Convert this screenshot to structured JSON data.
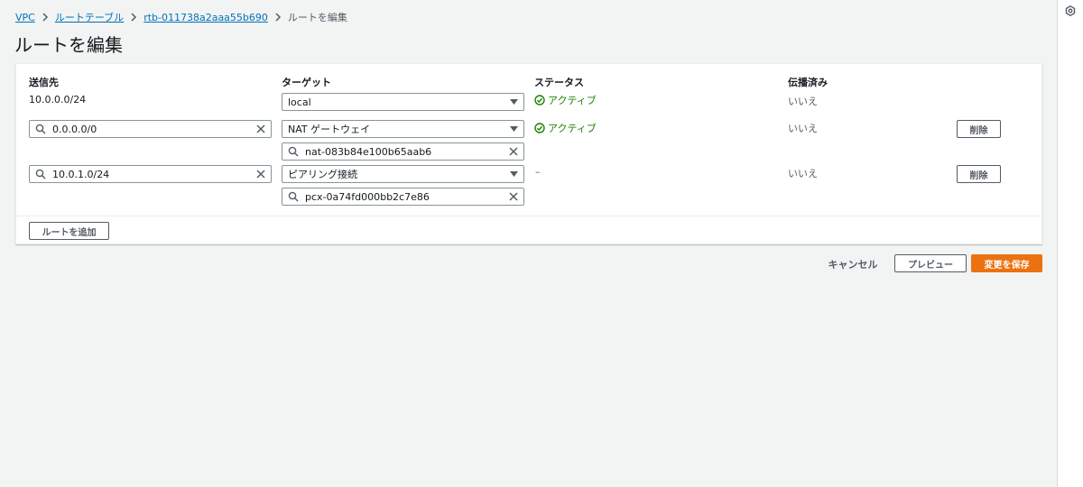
{
  "breadcrumb": {
    "items": [
      "VPC",
      "ルートテーブル",
      "rtb-011738a2aaa55b690"
    ],
    "current": "ルートを編集"
  },
  "page": {
    "title": "ルートを編集"
  },
  "table": {
    "headers": {
      "destination": "送信先",
      "target": "ターゲット",
      "status": "ステータス",
      "propagated": "伝播済み"
    },
    "rows": [
      {
        "destination": "10.0.0.0/24",
        "target_type": "local",
        "target_id": "",
        "status": "アクティブ",
        "propagated": "いいえ",
        "delete_label": ""
      },
      {
        "destination": "0.0.0.0/0",
        "target_type": "NAT ゲートウェイ",
        "target_id": "nat-083b84e100b65aab6",
        "status": "アクティブ",
        "propagated": "いいえ",
        "delete_label": "削除"
      },
      {
        "destination": "10.0.1.0/24",
        "target_type": "ピアリング接続",
        "target_id": "pcx-0a74fd000bb2c7e86",
        "status": "–",
        "propagated": "いいえ",
        "delete_label": "削除"
      }
    ],
    "add_route_label": "ルートを追加"
  },
  "footer": {
    "cancel_label": "キャンセル",
    "preview_label": "プレビュー",
    "save_label": "変更を保存"
  },
  "colors": {
    "link": "#0073bb",
    "success": "#1d8102",
    "primary": "#ec7211",
    "border": "#879596",
    "background": "#f2f3f3"
  },
  "icons": {
    "separator": "chevron-right-icon",
    "search": "search-icon",
    "clear": "close-icon",
    "select": "caret-down-icon",
    "status": "check-circle-icon",
    "rail": "gear-icon"
  }
}
